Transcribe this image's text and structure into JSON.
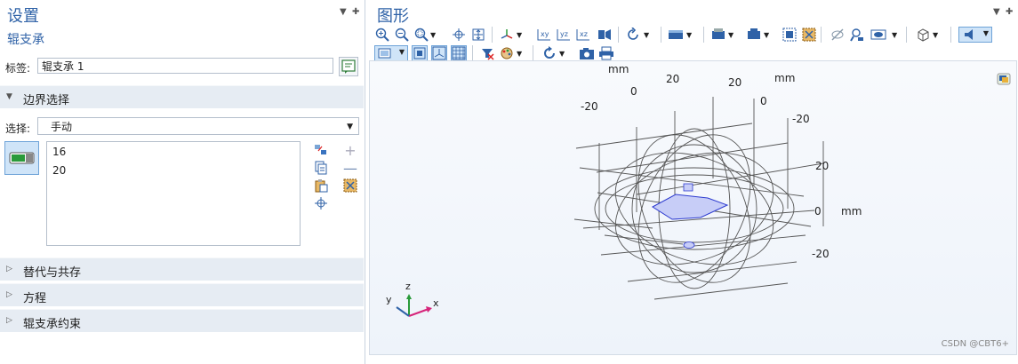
{
  "settings": {
    "title": "设置",
    "subtitle": "辊支承",
    "label_caption": "标签:",
    "label_value": "辊支承 1",
    "boundary_section": "边界选择",
    "select_caption": "选择:",
    "select_value": "手动",
    "boundaries": [
      "16",
      "20"
    ],
    "collapsed_sections": [
      "替代与共存",
      "方程",
      "辊支承约束"
    ]
  },
  "graphics": {
    "title": "图形",
    "axis_unit": "mm",
    "top_ticks": [
      "-20",
      "0",
      "20",
      "20",
      "0",
      "-20"
    ],
    "right_ticks": [
      "20",
      "0",
      "-20"
    ],
    "triad": {
      "x": "x",
      "y": "y",
      "z": "z"
    }
  },
  "watermark": "CSDN @CBT6+",
  "colors": {
    "accent": "#2f62a7",
    "section_bg": "#e6ecf3",
    "selection": "#c7cdf7",
    "selection_stroke": "#2d3bd0"
  }
}
